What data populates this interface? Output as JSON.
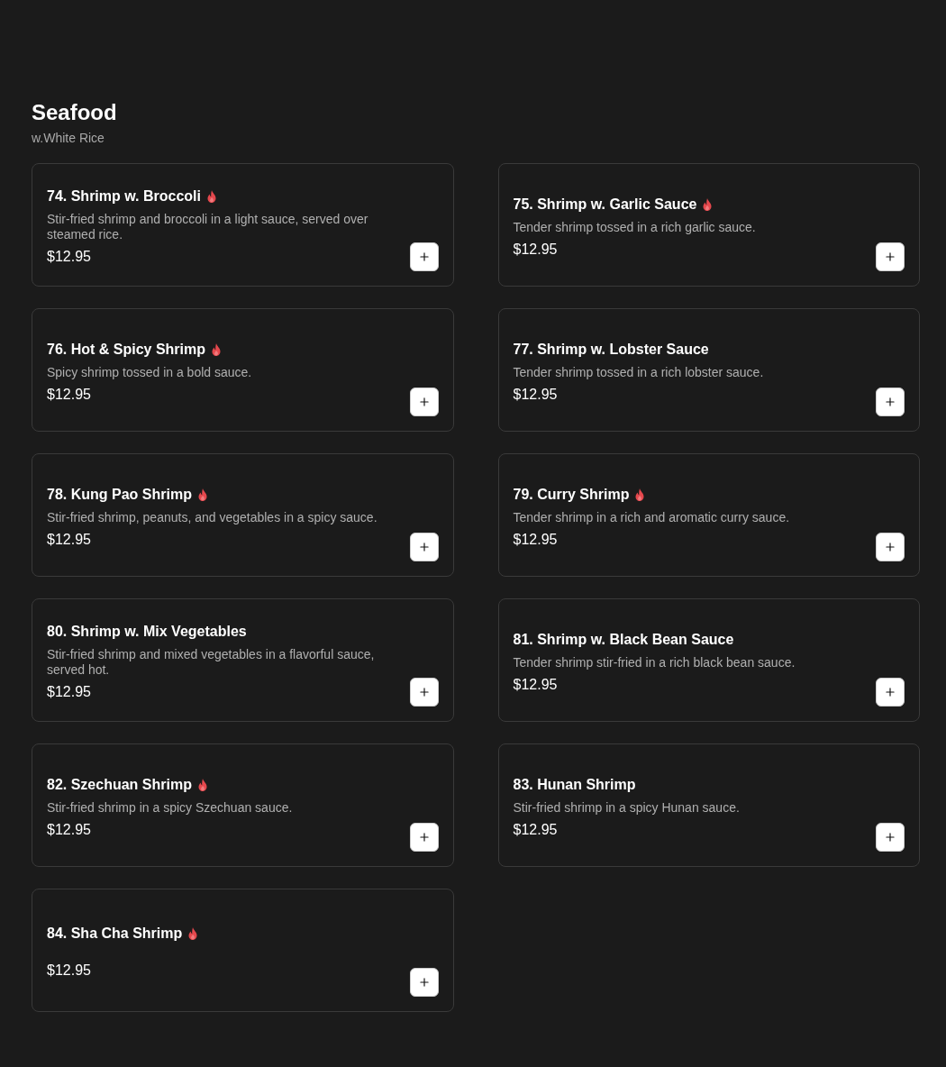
{
  "section": {
    "title": "Seafood",
    "subtitle": "w.White Rice"
  },
  "items": [
    {
      "name": "74. Shrimp w. Broccoli",
      "spicy": true,
      "description": "Stir-fried shrimp and broccoli in a light sauce, served over steamed rice.",
      "price": "$12.95"
    },
    {
      "name": "75. Shrimp w. Garlic Sauce",
      "spicy": true,
      "description": "Tender shrimp tossed in a rich garlic sauce.",
      "price": "$12.95"
    },
    {
      "name": "76. Hot & Spicy Shrimp",
      "spicy": true,
      "description": "Spicy shrimp tossed in a bold sauce.",
      "price": "$12.95"
    },
    {
      "name": "77. Shrimp w. Lobster Sauce",
      "spicy": false,
      "description": "Tender shrimp tossed in a rich lobster sauce.",
      "price": "$12.95"
    },
    {
      "name": "78. Kung Pao Shrimp",
      "spicy": true,
      "description": "Stir-fried shrimp, peanuts, and vegetables in a spicy sauce.",
      "price": "$12.95"
    },
    {
      "name": "79. Curry Shrimp",
      "spicy": true,
      "description": "Tender shrimp in a rich and aromatic curry sauce.",
      "price": "$12.95"
    },
    {
      "name": "80. Shrimp w. Mix Vegetables",
      "spicy": false,
      "description": "Stir-fried shrimp and mixed vegetables in a flavorful sauce, served hot.",
      "price": "$12.95"
    },
    {
      "name": "81. Shrimp w. Black Bean Sauce",
      "spicy": false,
      "description": "Tender shrimp stir-fried in a rich black bean sauce.",
      "price": "$12.95"
    },
    {
      "name": "82. Szechuan Shrimp",
      "spicy": true,
      "description": "Stir-fried shrimp in a spicy Szechuan sauce.",
      "price": "$12.95"
    },
    {
      "name": "83. Hunan Shrimp",
      "spicy": false,
      "description": "Stir-fried shrimp in a spicy Hunan sauce.",
      "price": "$12.95"
    },
    {
      "name": "84. Sha Cha Shrimp",
      "spicy": true,
      "price": "$12.95"
    }
  ]
}
